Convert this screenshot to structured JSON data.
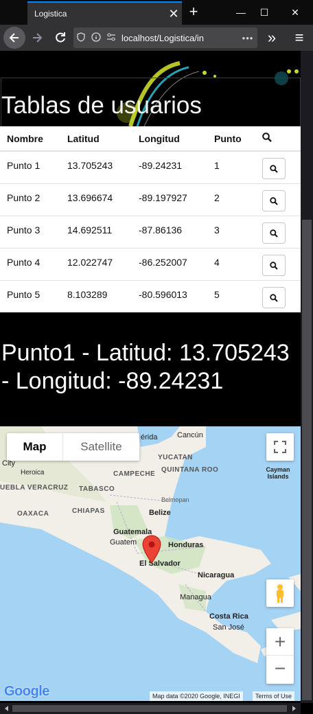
{
  "browser": {
    "tab_title": "Logistica",
    "url": "localhost/Logistica/in",
    "tab_close": "✕",
    "new_tab": "+",
    "win_min": "—",
    "win_max": "☐",
    "win_close": "✕",
    "overflow": "»",
    "menu": "≡",
    "url_more": "•••"
  },
  "page": {
    "title": "Tablas de usuarios",
    "table": {
      "headers": [
        "Nombre",
        "Latitud",
        "Longitud",
        "Punto"
      ],
      "rows": [
        {
          "nombre": "Punto 1",
          "latitud": "13.705243",
          "longitud": "-89.24231",
          "punto": "1"
        },
        {
          "nombre": "Punto 2",
          "latitud": "13.696674",
          "longitud": "-89.197927",
          "punto": "2"
        },
        {
          "nombre": "Punto 3",
          "latitud": "14.692511",
          "longitud": "-87.86136",
          "punto": "3"
        },
        {
          "nombre": "Punto 4",
          "latitud": "12.022747",
          "longitud": "-86.252007",
          "punto": "4"
        },
        {
          "nombre": "Punto 5",
          "latitud": "8.103289",
          "longitud": "-80.596013",
          "punto": "5"
        }
      ]
    },
    "selected_info": "Punto1 - Latitud: 13.705243 - Longitud: -89.24231"
  },
  "map": {
    "type_map": "Map",
    "type_satellite": "Satellite",
    "labels": {
      "merida": "érida",
      "cancun": "Cancún",
      "yucatan": "YUCATAN",
      "campeche": "CAMPECHE",
      "quintana_roo": "QUINTANA ROO",
      "city": "City",
      "heroica": "Heroica",
      "veracruz": "UEBLA VERACRUZ",
      "tabasco": "TABASCO",
      "belmopan": "Belmopan",
      "oaxaca": "OAXACA",
      "chiapas": "CHIAPAS",
      "belize": "Belize",
      "cayman": "Cayman Islands",
      "guatemala": "Guatemala",
      "guatem": "Guatem",
      "honduras": "Honduras",
      "el_salvador": "El Salvador",
      "nicaragua": "Nicaragua",
      "managua": "Managua",
      "costa_rica": "Costa Rica",
      "san_jose": "San José"
    },
    "google": "Google",
    "attribution": "Map data ©2020 Google, INEGI",
    "terms": "Terms of Use",
    "zoom_in": "+",
    "zoom_out": "−"
  },
  "colors": {
    "accent": "#0a84ff",
    "marker": "#ea4335",
    "water": "#a5d3f4",
    "land": "#f2efe9"
  }
}
